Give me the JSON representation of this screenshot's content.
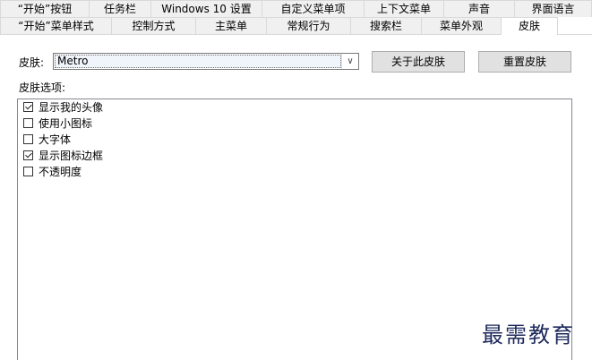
{
  "tabs_row1": [
    {
      "label": "“开始”按钮"
    },
    {
      "label": "任务栏"
    },
    {
      "label": "Windows 10 设置"
    },
    {
      "label": "自定义菜单项"
    },
    {
      "label": "上下文菜单"
    },
    {
      "label": "声音"
    },
    {
      "label": "界面语言"
    }
  ],
  "tabs_row2": [
    {
      "label": "“开始”菜单样式"
    },
    {
      "label": "控制方式"
    },
    {
      "label": "主菜单"
    },
    {
      "label": "常规行为"
    },
    {
      "label": "搜索栏"
    },
    {
      "label": "菜单外观"
    },
    {
      "label": "皮肤",
      "active": true
    }
  ],
  "skin": {
    "label": "皮肤:",
    "selected": "Metro",
    "dropdown_arrow": "chevron-down-icon",
    "about_button": "关于此皮肤",
    "reset_button": "重置皮肤"
  },
  "options": {
    "label": "皮肤选项:",
    "items": [
      {
        "label": "显示我的头像",
        "checked": true
      },
      {
        "label": "使用小图标",
        "checked": false
      },
      {
        "label": "大字体",
        "checked": false
      },
      {
        "label": "显示图标边框",
        "checked": true
      },
      {
        "label": "不透明度",
        "checked": false
      }
    ]
  },
  "watermark": "最需教育"
}
